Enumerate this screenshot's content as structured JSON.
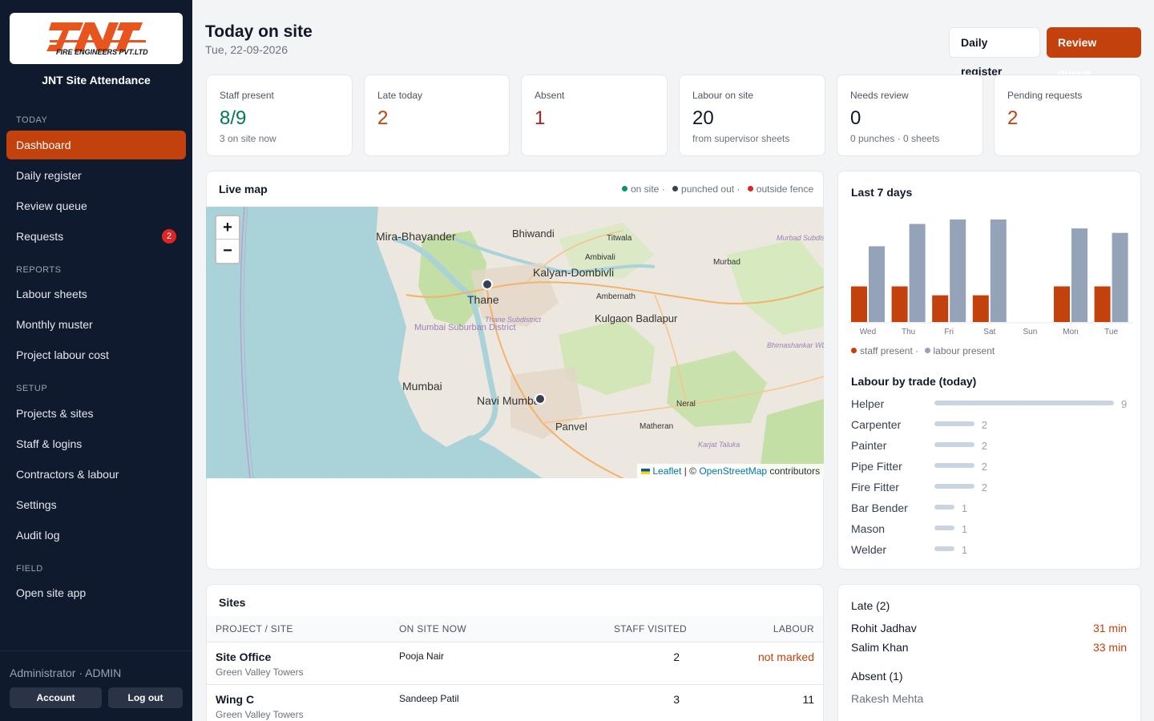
{
  "sidebar": {
    "logo_text": "JNT",
    "logo_sub": "FIRE ENGINEERS PVT.LTD",
    "brand": "JNT Site Attendance",
    "sections": {
      "today": "TODAY",
      "reports": "REPORTS",
      "setup": "SETUP",
      "field": "FIELD"
    },
    "items": {
      "dashboard": "Dashboard",
      "daily_register": "Daily register",
      "review_queue": "Review queue",
      "requests": "Requests",
      "requests_badge": "2",
      "labour_sheets": "Labour sheets",
      "monthly_muster": "Monthly muster",
      "project_labour_cost": "Project labour cost",
      "projects_sites": "Projects & sites",
      "staff_logins": "Staff & logins",
      "contractors_labour": "Contractors & labour",
      "settings": "Settings",
      "audit_log": "Audit log",
      "open_site_app": "Open site app"
    },
    "user": "Administrator · ADMIN",
    "account": "Account",
    "logout": "Log out"
  },
  "header": {
    "title": "Today on site",
    "date": "Tue, 22-09-2026",
    "daily_register_btn": "Daily register",
    "review_queue_btn": "Review queue"
  },
  "stats": [
    {
      "label": "Staff present",
      "value": "8/9",
      "sub": "3 on site now",
      "color": "#047857"
    },
    {
      "label": "Late today",
      "value": "2",
      "sub": "",
      "color": "#c2410c"
    },
    {
      "label": "Absent",
      "value": "1",
      "sub": "",
      "color": "#b91c1c"
    },
    {
      "label": "Labour on site",
      "value": "20",
      "sub": "from supervisor sheets",
      "color": "#111827"
    },
    {
      "label": "Needs review",
      "value": "0",
      "sub": "0 punches · 0 sheets",
      "color": "#111827"
    },
    {
      "label": "Pending requests",
      "value": "2",
      "sub": "",
      "color": "#c2410c"
    }
  ],
  "live_map": {
    "title": "Live map",
    "legend": {
      "on_site": "on site ·",
      "punched_out": "punched out ·",
      "outside_fence": "outside fence"
    },
    "zoom_in": "+",
    "zoom_out": "−",
    "places": [
      "Mira-Bhayander",
      "Bhiwandi",
      "Titwala",
      "Ambivali",
      "Kalyan-Dombivli",
      "Murbad",
      "Murbad Subdistrict",
      "Thane",
      "Thane Subdistrict",
      "Ambernath",
      "Kulgaon Badlapur",
      "Mumbai Suburban District",
      "Mumbai",
      "Navi Mumbai",
      "Panvel",
      "Matheran",
      "Neral",
      "Karjat Taluka",
      "Bhimashankar WL"
    ],
    "attribution": {
      "leaflet": "Leaflet",
      "sep": " | © ",
      "osm": "OpenStreetMap",
      "tail": " contributors"
    }
  },
  "last7": {
    "title": "Last 7 days",
    "legend_staff": "staff present ·",
    "legend_labour": "labour present",
    "colors": {
      "staff": "#c2410c",
      "labour": "#94a3b8"
    },
    "chart_data": {
      "type": "bar",
      "categories": [
        "Wed",
        "Thu",
        "Fri",
        "Sat",
        "Sun",
        "Mon",
        "Tue"
      ],
      "series": [
        {
          "name": "staff present",
          "values": [
            8,
            8,
            6,
            6,
            0,
            8,
            8
          ]
        },
        {
          "name": "labour present",
          "values": [
            17,
            22,
            23,
            23,
            0,
            21,
            20
          ]
        }
      ],
      "ylim": [
        0,
        23
      ]
    }
  },
  "trades": {
    "title": "Labour by trade (today)",
    "max": 9,
    "items": [
      {
        "name": "Helper",
        "count": "9",
        "value": 9
      },
      {
        "name": "Carpenter",
        "count": "2",
        "value": 2
      },
      {
        "name": "Painter",
        "count": "2",
        "value": 2
      },
      {
        "name": "Pipe Fitter",
        "count": "2",
        "value": 2
      },
      {
        "name": "Fire Fitter",
        "count": "2",
        "value": 2
      },
      {
        "name": "Bar Bender",
        "count": "1",
        "value": 1
      },
      {
        "name": "Mason",
        "count": "1",
        "value": 1
      },
      {
        "name": "Welder",
        "count": "1",
        "value": 1
      }
    ]
  },
  "sites": {
    "title": "Sites",
    "columns": {
      "project": "PROJECT / SITE",
      "on_site": "ON SITE NOW",
      "staff": "STAFF VISITED",
      "labour": "LABOUR"
    },
    "rows": [
      {
        "site": "Site Office",
        "project": "Green Valley Towers",
        "on_site": "Pooja Nair",
        "staff": "2",
        "labour": "not marked"
      },
      {
        "site": "Wing C",
        "project": "Green Valley Towers",
        "on_site": "Sandeep Patil",
        "staff": "3",
        "labour": "11"
      }
    ]
  },
  "late": {
    "title": "Late (2)",
    "items": [
      {
        "name": "Rohit Jadhav",
        "time": "31 min"
      },
      {
        "name": "Salim Khan",
        "time": "33 min"
      }
    ],
    "absent_title": "Absent (1)",
    "absent": [
      "Rakesh Mehta"
    ]
  }
}
